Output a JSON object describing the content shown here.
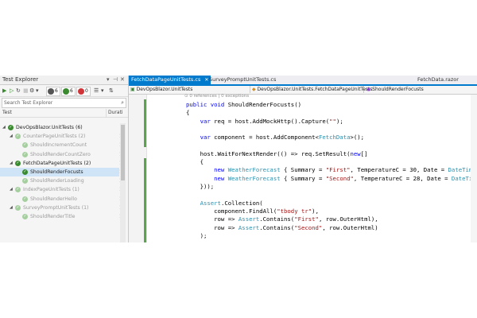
{
  "test_explorer": {
    "title": "Test Explorer",
    "toolbar": {
      "counts": [
        {
          "value": "6",
          "color": "#555555"
        },
        {
          "value": "6",
          "color": "#3a8a2f"
        },
        {
          "value": "0",
          "color": "#d13438"
        }
      ]
    },
    "search_placeholder": "Search Test Explorer",
    "columns": {
      "test": "Test",
      "duration": "Durati"
    },
    "tree": [
      {
        "label": "DevOpsBlazor.UnitTests (6)",
        "level": 0,
        "expanded": true,
        "dim": false,
        "selected": false,
        "duration": ""
      },
      {
        "label": "CounterPageUnitTests (2)",
        "level": 1,
        "expanded": true,
        "dim": true,
        "selected": false,
        "duration": "1"
      },
      {
        "label": "ShouldIncrementCount",
        "level": 2,
        "expanded": false,
        "dim": true,
        "selected": false,
        "duration": "1"
      },
      {
        "label": "ShouldRenderCountZero",
        "level": 2,
        "expanded": false,
        "dim": true,
        "selected": false,
        "duration": "1"
      },
      {
        "label": "FetchDataPageUnitTests (2)",
        "level": 1,
        "expanded": true,
        "dim": false,
        "selected": false,
        "duration": "1"
      },
      {
        "label": "ShouldRenderFocusts",
        "level": 2,
        "expanded": false,
        "dim": false,
        "selected": true,
        "duration": "1"
      },
      {
        "label": "ShouldRenderLoading",
        "level": 2,
        "expanded": false,
        "dim": true,
        "selected": false,
        "duration": "1"
      },
      {
        "label": "IndexPageUnitTests (1)",
        "level": 1,
        "expanded": true,
        "dim": true,
        "selected": false,
        "duration": "1"
      },
      {
        "label": "ShouldRenderHello",
        "level": 2,
        "expanded": false,
        "dim": true,
        "selected": false,
        "duration": "1"
      },
      {
        "label": "SurveyPromptUnitTests (1)",
        "level": 1,
        "expanded": true,
        "dim": true,
        "selected": false,
        "duration": "1"
      },
      {
        "label": "ShouldRenderTitle",
        "level": 2,
        "expanded": false,
        "dim": true,
        "selected": false,
        "duration": "1"
      }
    ]
  },
  "editor": {
    "tabs": [
      {
        "label": "FetchDataPageUnitTests.cs",
        "active": true
      },
      {
        "label": "SurveyPromptUnitTests.cs",
        "active": false
      },
      {
        "label": "FetchData.razor",
        "active": false
      }
    ],
    "nav": {
      "project": "DevOpsBlazor.UnitTests",
      "class": "DevOpsBlazor.UnitTests.FetchDataPageUnitTests",
      "member": "ShouldRenderFocusts"
    },
    "codelens": "0 references | 0 exceptions",
    "code_lines": [
      [
        {
          "t": "public void ",
          "c": "kw"
        },
        {
          "t": "ShouldRenderFocusts()",
          "c": ""
        }
      ],
      [
        {
          "t": "{",
          "c": ""
        }
      ],
      [
        {
          "t": "    var ",
          "c": "kw"
        },
        {
          "t": "req = host.AddMockHttp().Capture(",
          "c": ""
        },
        {
          "t": "\"\"",
          "c": "st"
        },
        {
          "t": ");",
          "c": ""
        }
      ],
      [],
      [
        {
          "t": "    var ",
          "c": "kw"
        },
        {
          "t": "component = host.AddComponent<",
          "c": ""
        },
        {
          "t": "FetchData",
          "c": "ty"
        },
        {
          "t": ">();",
          "c": ""
        }
      ],
      [],
      [
        {
          "t": "    host.WaitForNextRender(() => req.SetResult(",
          "c": ""
        },
        {
          "t": "new",
          "c": "kw"
        },
        {
          "t": "[]",
          "c": ""
        }
      ],
      [
        {
          "t": "    {",
          "c": ""
        }
      ],
      [
        {
          "t": "        new ",
          "c": "kw"
        },
        {
          "t": "WeatherForecast",
          "c": "ty"
        },
        {
          "t": " { Summary = ",
          "c": ""
        },
        {
          "t": "\"First\"",
          "c": "st"
        },
        {
          "t": ", TemperatureC = 30, Date = ",
          "c": ""
        },
        {
          "t": "DateTime",
          "c": "ty"
        },
        {
          "t": ".",
          "c": ""
        }
      ],
      [
        {
          "t": "        new ",
          "c": "kw"
        },
        {
          "t": "WeatherForecast",
          "c": "ty"
        },
        {
          "t": " { Summary = ",
          "c": ""
        },
        {
          "t": "\"Second\"",
          "c": "st"
        },
        {
          "t": ", TemperatureC = 28, Date = ",
          "c": ""
        },
        {
          "t": "DateTim",
          "c": "ty"
        }
      ],
      [
        {
          "t": "    }));",
          "c": ""
        }
      ],
      [],
      [
        {
          "t": "    ",
          "c": ""
        },
        {
          "t": "Assert",
          "c": "ty"
        },
        {
          "t": ".Collection(",
          "c": ""
        }
      ],
      [
        {
          "t": "        component.FindAll(",
          "c": ""
        },
        {
          "t": "\"tbody tr\"",
          "c": "st"
        },
        {
          "t": "),",
          "c": ""
        }
      ],
      [
        {
          "t": "        row => ",
          "c": ""
        },
        {
          "t": "Assert",
          "c": "ty"
        },
        {
          "t": ".Contains(",
          "c": ""
        },
        {
          "t": "\"First\"",
          "c": "st"
        },
        {
          "t": ", row.OuterHtml),",
          "c": ""
        }
      ],
      [
        {
          "t": "        row => ",
          "c": ""
        },
        {
          "t": "Assert",
          "c": "ty"
        },
        {
          "t": ".Contains(",
          "c": ""
        },
        {
          "t": "\"Second\"",
          "c": "st"
        },
        {
          "t": ", row.OuterHtml)",
          "c": ""
        }
      ],
      [
        {
          "t": "    );",
          "c": ""
        }
      ]
    ]
  }
}
